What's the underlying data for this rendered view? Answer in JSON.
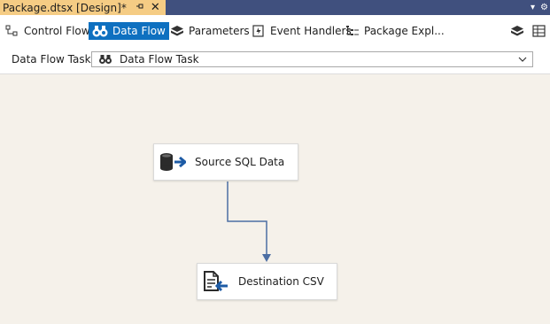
{
  "document_tab": {
    "title": "Package.dtsx [Design]*",
    "pin_icon": "pin-icon",
    "close_icon": "close-icon"
  },
  "designer_tabs": [
    {
      "label": "Control Flow",
      "icon": "control-flow-icon",
      "active": false
    },
    {
      "label": "Data Flow",
      "icon": "data-flow-icon",
      "active": true
    },
    {
      "label": "Parameters",
      "icon": "parameters-icon",
      "active": false
    },
    {
      "label": "Event Handlers",
      "icon": "event-handlers-icon",
      "active": false
    },
    {
      "label": "Package Expl...",
      "icon": "package-explorer-icon",
      "active": false
    }
  ],
  "task_selector": {
    "label": "Data Flow Task:",
    "value": "Data Flow Task"
  },
  "components": [
    {
      "label": "Source SQL Data",
      "icon": "sql-source-icon"
    },
    {
      "label": "Destination CSV",
      "icon": "flat-file-destination-icon"
    }
  ],
  "colors": {
    "title_bar": "#40507e",
    "tab_active_doc": "#f5cc84",
    "tab_selected": "#0e70c0",
    "canvas": "#f5f1ea",
    "connector": "#4d6fa3"
  }
}
